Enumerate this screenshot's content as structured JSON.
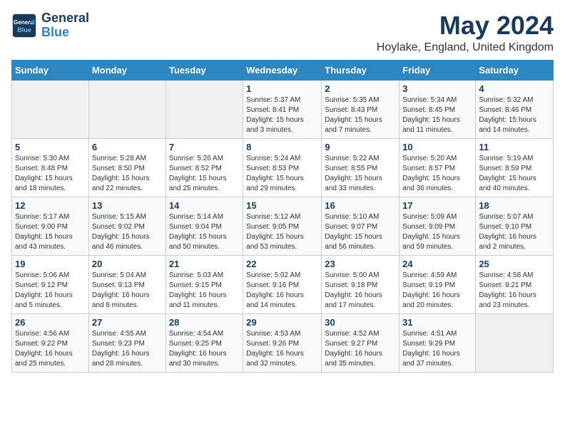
{
  "header": {
    "logo_line1": "General",
    "logo_line2": "Blue",
    "title": "May 2024",
    "subtitle": "Hoylake, England, United Kingdom"
  },
  "weekdays": [
    "Sunday",
    "Monday",
    "Tuesday",
    "Wednesday",
    "Thursday",
    "Friday",
    "Saturday"
  ],
  "weeks": [
    [
      {
        "num": "",
        "info": ""
      },
      {
        "num": "",
        "info": ""
      },
      {
        "num": "",
        "info": ""
      },
      {
        "num": "1",
        "info": "Sunrise: 5:37 AM\nSunset: 8:41 PM\nDaylight: 15 hours\nand 3 minutes."
      },
      {
        "num": "2",
        "info": "Sunrise: 5:35 AM\nSunset: 8:43 PM\nDaylight: 15 hours\nand 7 minutes."
      },
      {
        "num": "3",
        "info": "Sunrise: 5:34 AM\nSunset: 8:45 PM\nDaylight: 15 hours\nand 11 minutes."
      },
      {
        "num": "4",
        "info": "Sunrise: 5:32 AM\nSunset: 8:46 PM\nDaylight: 15 hours\nand 14 minutes."
      }
    ],
    [
      {
        "num": "5",
        "info": "Sunrise: 5:30 AM\nSunset: 8:48 PM\nDaylight: 15 hours\nand 18 minutes."
      },
      {
        "num": "6",
        "info": "Sunrise: 5:28 AM\nSunset: 8:50 PM\nDaylight: 15 hours\nand 22 minutes."
      },
      {
        "num": "7",
        "info": "Sunrise: 5:26 AM\nSunset: 8:52 PM\nDaylight: 15 hours\nand 25 minutes."
      },
      {
        "num": "8",
        "info": "Sunrise: 5:24 AM\nSunset: 8:53 PM\nDaylight: 15 hours\nand 29 minutes."
      },
      {
        "num": "9",
        "info": "Sunrise: 5:22 AM\nSunset: 8:55 PM\nDaylight: 15 hours\nand 33 minutes."
      },
      {
        "num": "10",
        "info": "Sunrise: 5:20 AM\nSunset: 8:57 PM\nDaylight: 15 hours\nand 36 minutes."
      },
      {
        "num": "11",
        "info": "Sunrise: 5:19 AM\nSunset: 8:59 PM\nDaylight: 15 hours\nand 40 minutes."
      }
    ],
    [
      {
        "num": "12",
        "info": "Sunrise: 5:17 AM\nSunset: 9:00 PM\nDaylight: 15 hours\nand 43 minutes."
      },
      {
        "num": "13",
        "info": "Sunrise: 5:15 AM\nSunset: 9:02 PM\nDaylight: 15 hours\nand 46 minutes."
      },
      {
        "num": "14",
        "info": "Sunrise: 5:14 AM\nSunset: 9:04 PM\nDaylight: 15 hours\nand 50 minutes."
      },
      {
        "num": "15",
        "info": "Sunrise: 5:12 AM\nSunset: 9:05 PM\nDaylight: 15 hours\nand 53 minutes."
      },
      {
        "num": "16",
        "info": "Sunrise: 5:10 AM\nSunset: 9:07 PM\nDaylight: 15 hours\nand 56 minutes."
      },
      {
        "num": "17",
        "info": "Sunrise: 5:09 AM\nSunset: 9:09 PM\nDaylight: 15 hours\nand 59 minutes."
      },
      {
        "num": "18",
        "info": "Sunrise: 5:07 AM\nSunset: 9:10 PM\nDaylight: 16 hours\nand 2 minutes."
      }
    ],
    [
      {
        "num": "19",
        "info": "Sunrise: 5:06 AM\nSunset: 9:12 PM\nDaylight: 16 hours\nand 5 minutes."
      },
      {
        "num": "20",
        "info": "Sunrise: 5:04 AM\nSunset: 9:13 PM\nDaylight: 16 hours\nand 8 minutes."
      },
      {
        "num": "21",
        "info": "Sunrise: 5:03 AM\nSunset: 9:15 PM\nDaylight: 16 hours\nand 11 minutes."
      },
      {
        "num": "22",
        "info": "Sunrise: 5:02 AM\nSunset: 9:16 PM\nDaylight: 16 hours\nand 14 minutes."
      },
      {
        "num": "23",
        "info": "Sunrise: 5:00 AM\nSunset: 9:18 PM\nDaylight: 16 hours\nand 17 minutes."
      },
      {
        "num": "24",
        "info": "Sunrise: 4:59 AM\nSunset: 9:19 PM\nDaylight: 16 hours\nand 20 minutes."
      },
      {
        "num": "25",
        "info": "Sunrise: 4:58 AM\nSunset: 9:21 PM\nDaylight: 16 hours\nand 23 minutes."
      }
    ],
    [
      {
        "num": "26",
        "info": "Sunrise: 4:56 AM\nSunset: 9:22 PM\nDaylight: 16 hours\nand 25 minutes."
      },
      {
        "num": "27",
        "info": "Sunrise: 4:55 AM\nSunset: 9:23 PM\nDaylight: 16 hours\nand 28 minutes."
      },
      {
        "num": "28",
        "info": "Sunrise: 4:54 AM\nSunset: 9:25 PM\nDaylight: 16 hours\nand 30 minutes."
      },
      {
        "num": "29",
        "info": "Sunrise: 4:53 AM\nSunset: 9:26 PM\nDaylight: 16 hours\nand 32 minutes."
      },
      {
        "num": "30",
        "info": "Sunrise: 4:52 AM\nSunset: 9:27 PM\nDaylight: 16 hours\nand 35 minutes."
      },
      {
        "num": "31",
        "info": "Sunrise: 4:51 AM\nSunset: 9:29 PM\nDaylight: 16 hours\nand 37 minutes."
      },
      {
        "num": "",
        "info": ""
      }
    ]
  ]
}
